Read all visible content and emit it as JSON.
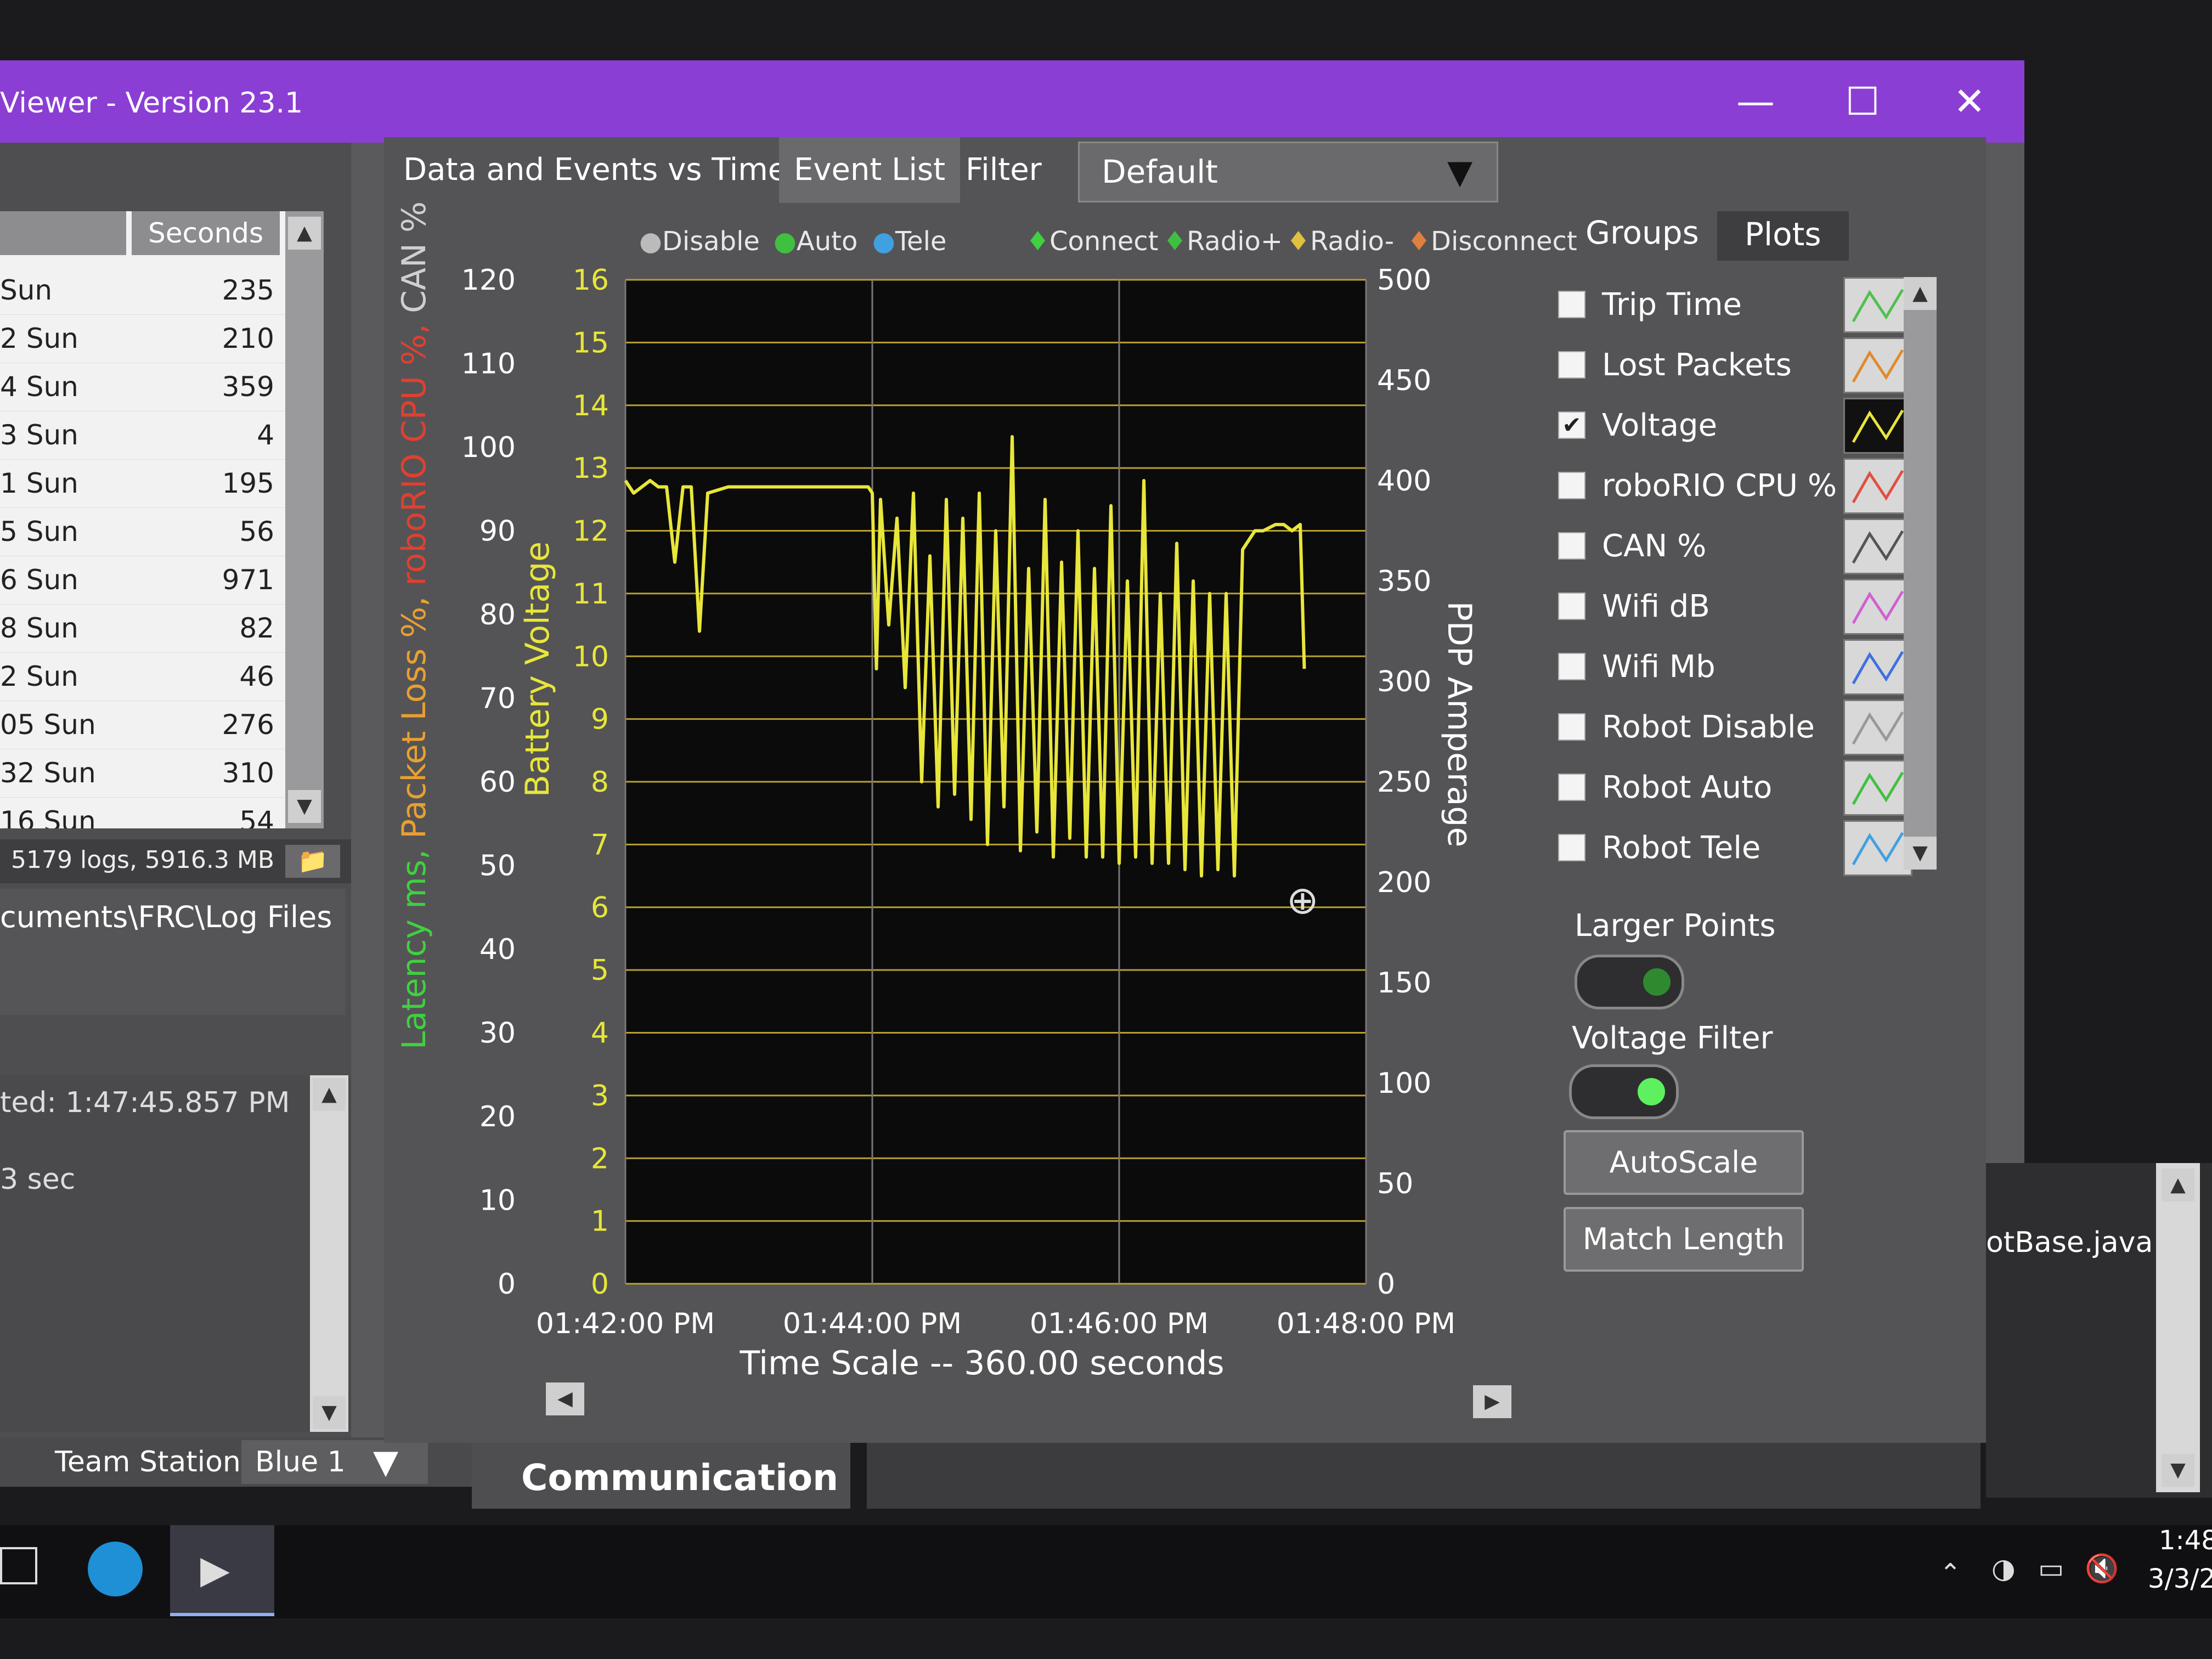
{
  "window": {
    "title": "Viewer - Version 23.1",
    "min_icon": "minimize-icon",
    "max_icon": "maximize-icon",
    "close_icon": "close-icon",
    "accent": "#8b3ed4"
  },
  "log_list": {
    "column_seconds": "Seconds",
    "rows": [
      {
        "name": "Sun",
        "seconds": "235"
      },
      {
        "name": "2 Sun",
        "seconds": "210"
      },
      {
        "name": "4 Sun",
        "seconds": "359"
      },
      {
        "name": "3 Sun",
        "seconds": "4"
      },
      {
        "name": "1 Sun",
        "seconds": "195"
      },
      {
        "name": "5 Sun",
        "seconds": "56"
      },
      {
        "name": "6 Sun",
        "seconds": "971"
      },
      {
        "name": "8 Sun",
        "seconds": "82"
      },
      {
        "name": "2 Sun",
        "seconds": "46"
      },
      {
        "name": "05 Sun",
        "seconds": "276"
      },
      {
        "name": "32 Sun",
        "seconds": "310"
      },
      {
        "name": "16 Sun",
        "seconds": "54"
      }
    ],
    "summary": "5179 logs, 5916.3 MB",
    "path": "cuments\\FRC\\Log Files"
  },
  "info_box": {
    "line1": "ted:  1:47:45.857 PM",
    "line2": "3 sec"
  },
  "bottom": {
    "team_station_label": "Team Station",
    "team_station_value": "Blue 1",
    "communication_label": "Communication",
    "robotbase": "otBase.java:"
  },
  "tabs": {
    "data_events": "Data and Events vs Time",
    "event_list": "Event List",
    "filter": "Filter",
    "filter_value": "Default",
    "groups": "Groups",
    "plots": "Plots"
  },
  "legend": {
    "disable": "Disable",
    "auto": "Auto",
    "tele": "Tele",
    "connect": "Connect",
    "radio_plus": "Radio+",
    "radio_minus": "Radio-",
    "disconnect": "Disconnect"
  },
  "chart_data": {
    "type": "line",
    "xlabel": "Time Scale -- 360.00 seconds",
    "x_ticks": [
      "01:42:00 PM",
      "01:44:00 PM",
      "01:46:00 PM",
      "01:48:00 PM"
    ],
    "y1_label_parts": [
      "Latency ms, ",
      "Packet Loss %, ",
      "roboRIO CPU %, ",
      "CAN %"
    ],
    "y1_ticks": [
      "0",
      "10",
      "20",
      "30",
      "40",
      "50",
      "60",
      "70",
      "80",
      "90",
      "100",
      "110",
      "120"
    ],
    "y1_range": [
      0,
      120
    ],
    "y2_label": "Battery Voltage",
    "y2_ticks": [
      "0",
      "1",
      "2",
      "3",
      "4",
      "5",
      "6",
      "7",
      "8",
      "9",
      "10",
      "11",
      "12",
      "13",
      "14",
      "15",
      "16"
    ],
    "y2_range": [
      0,
      16
    ],
    "y3_label": "PDP Amperage",
    "y3_ticks": [
      "0",
      "50",
      "100",
      "150",
      "200",
      "250",
      "300",
      "350",
      "400",
      "450",
      "500"
    ],
    "y3_range": [
      0,
      500
    ],
    "x_range": [
      0,
      360
    ],
    "series": [
      {
        "name": "Voltage",
        "color": "#e8e63a",
        "x": [
          0,
          4,
          8,
          12,
          16,
          20,
          24,
          28,
          30,
          32,
          36,
          40,
          50,
          60,
          70,
          80,
          90,
          100,
          110,
          118,
          120,
          122,
          124,
          128,
          132,
          136,
          140,
          144,
          148,
          152,
          156,
          160,
          164,
          168,
          172,
          176,
          180,
          184,
          188,
          192,
          196,
          200,
          204,
          208,
          212,
          216,
          220,
          224,
          228,
          232,
          236,
          240,
          244,
          248,
          252,
          256,
          260,
          264,
          268,
          272,
          276,
          280,
          284,
          288,
          292,
          296,
          300,
          304,
          306,
          310,
          316,
          320,
          324,
          328,
          330
        ],
        "y": [
          12.8,
          12.6,
          12.7,
          12.8,
          12.7,
          12.7,
          11.5,
          12.7,
          12.7,
          12.7,
          10.4,
          12.6,
          12.7,
          12.7,
          12.7,
          12.7,
          12.7,
          12.7,
          12.7,
          12.7,
          12.6,
          9.8,
          12.5,
          10.5,
          12.2,
          9.5,
          12.6,
          8.0,
          11.6,
          7.6,
          12.5,
          7.8,
          12.2,
          7.4,
          12.6,
          7.0,
          12.0,
          7.6,
          13.5,
          6.9,
          11.4,
          7.2,
          12.5,
          6.8,
          11.5,
          7.1,
          12.0,
          6.8,
          11.4,
          6.8,
          12.4,
          6.7,
          11.2,
          6.8,
          12.8,
          6.7,
          11.0,
          6.7,
          11.8,
          6.6,
          11.2,
          6.5,
          11.0,
          6.6,
          11.0,
          6.5,
          11.7,
          11.9,
          12.0,
          12.0,
          12.1,
          12.1,
          12.0,
          12.1,
          9.8
        ]
      }
    ]
  },
  "plots_panel": {
    "items": [
      {
        "label": "Trip Time",
        "checked": false,
        "color": "#4fc04f"
      },
      {
        "label": "Lost Packets",
        "checked": false,
        "color": "#e08a2c"
      },
      {
        "label": "Voltage",
        "checked": true,
        "color": "#e8e63a"
      },
      {
        "label": "roboRIO CPU %",
        "checked": false,
        "color": "#e05040"
      },
      {
        "label": "CAN %",
        "checked": false,
        "color": "#555555"
      },
      {
        "label": "Wifi dB",
        "checked": false,
        "color": "#d060d0"
      },
      {
        "label": "Wifi Mb",
        "checked": false,
        "color": "#4070e0"
      },
      {
        "label": "Robot Disable",
        "checked": false,
        "color": "#999999"
      },
      {
        "label": "Robot Auto",
        "checked": false,
        "color": "#40c040"
      },
      {
        "label": "Robot Tele",
        "checked": false,
        "color": "#40a0e0"
      }
    ],
    "larger_points": "Larger Points",
    "voltage_filter": "Voltage Filter",
    "autoscale": "AutoScale",
    "match_length": "Match Length"
  },
  "taskbar": {
    "time": "1:48",
    "date": "3/3/2"
  }
}
